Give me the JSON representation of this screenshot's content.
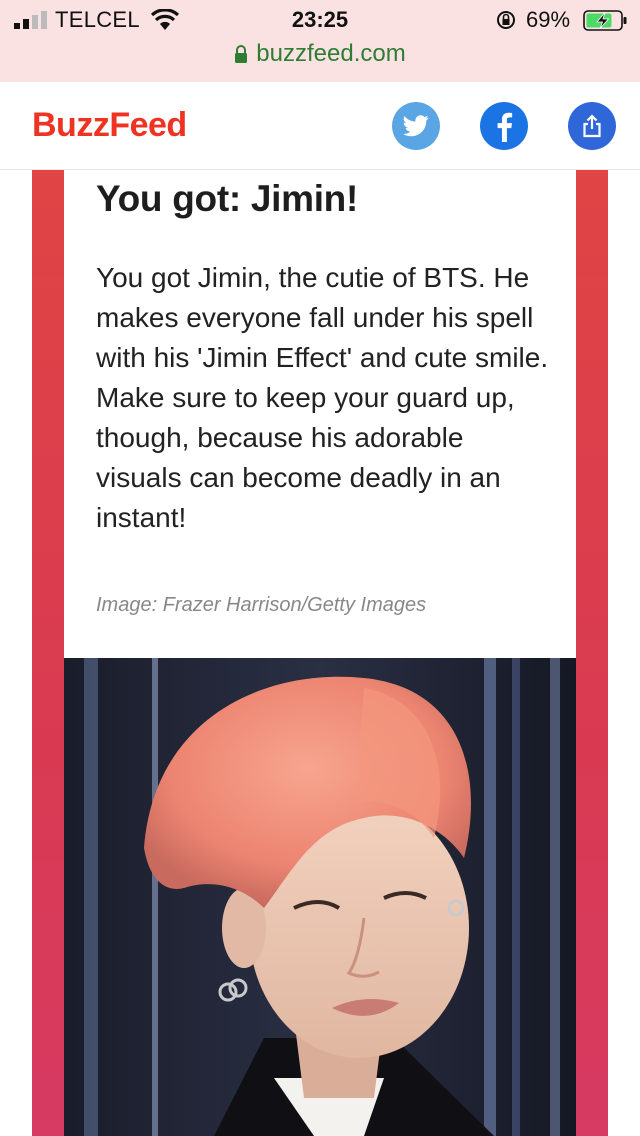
{
  "status_bar": {
    "carrier": "TELCEL",
    "time": "23:25",
    "battery_percent": "69%",
    "signal_bars_filled": 2,
    "signal_bars_total": 4
  },
  "browser": {
    "url": "buzzfeed.com"
  },
  "header": {
    "logo_text": "BuzzFeed",
    "buttons": [
      "twitter-icon",
      "facebook-icon",
      "share-icon"
    ]
  },
  "result": {
    "title": "You got: Jimin!",
    "description": "You got Jimin, the cutie of BTS. He makes everyone fall under his spell with his 'Jimin Effect' and cute smile. Make sure to keep your guard up, though, because his adorable visuals can become deadly in an instant!",
    "image_credit": "Image: Frazer Harrison/Getty Images"
  },
  "colors": {
    "brand_red": "#ee3322",
    "twitter": "#5aa5e3",
    "facebook": "#1b74e4",
    "share": "#2f67d8",
    "frame": "#d93a52"
  }
}
